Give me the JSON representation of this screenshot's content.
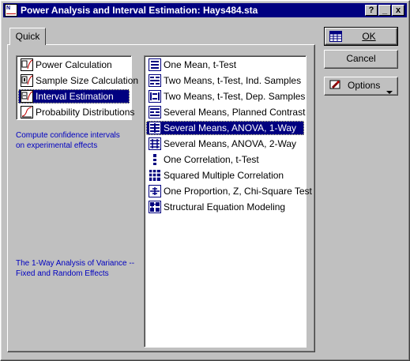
{
  "window": {
    "title": "Power Analysis and Interval Estimation: Hays484.sta",
    "controls": {
      "help": "?",
      "minimize": "_",
      "close": "x"
    }
  },
  "tabs": [
    {
      "label": "Quick"
    }
  ],
  "categories": [
    {
      "label": "Power Calculation",
      "icon": "power-calc-icon"
    },
    {
      "label": "Sample Size Calculation",
      "icon": "sample-size-icon"
    },
    {
      "label": "Interval Estimation",
      "icon": "interval-est-icon"
    },
    {
      "label": "Probability Distributions",
      "icon": "prob-dist-icon"
    }
  ],
  "selected_category": "Interval Estimation",
  "category_description": "Compute confidence intervals\non experimental effects",
  "analyses": [
    {
      "label": "One Mean, t-Test",
      "icon": "one-mean-icon"
    },
    {
      "label": "Two Means, t-Test, Ind. Samples",
      "icon": "two-means-ind-icon"
    },
    {
      "label": "Two Means, t-Test, Dep. Samples",
      "icon": "two-means-dep-icon"
    },
    {
      "label": "Several Means, Planned Contrast",
      "icon": "planned-contrast-icon"
    },
    {
      "label": "Several Means, ANOVA, 1-Way",
      "icon": "anova-1way-icon"
    },
    {
      "label": "Several Means, ANOVA, 2-Way",
      "icon": "anova-2way-icon"
    },
    {
      "label": "One Correlation, t-Test",
      "icon": "one-correlation-icon"
    },
    {
      "label": "Squared Multiple Correlation",
      "icon": "squared-multiple-icon"
    },
    {
      "label": "One Proportion, Z, Chi-Square Test",
      "icon": "one-proportion-icon"
    },
    {
      "label": "Structural Equation Modeling",
      "icon": "sem-icon"
    }
  ],
  "selected_analysis": "Several Means, ANOVA, 1-Way",
  "analysis_description": "The 1-Way Analysis of Variance --\nFixed and Random Effects",
  "buttons": {
    "ok": "OK",
    "cancel": "Cancel",
    "options": "Options"
  },
  "colors": {
    "selection": "#000080",
    "description_text": "#0000c0",
    "face": "#c0c0c0"
  }
}
